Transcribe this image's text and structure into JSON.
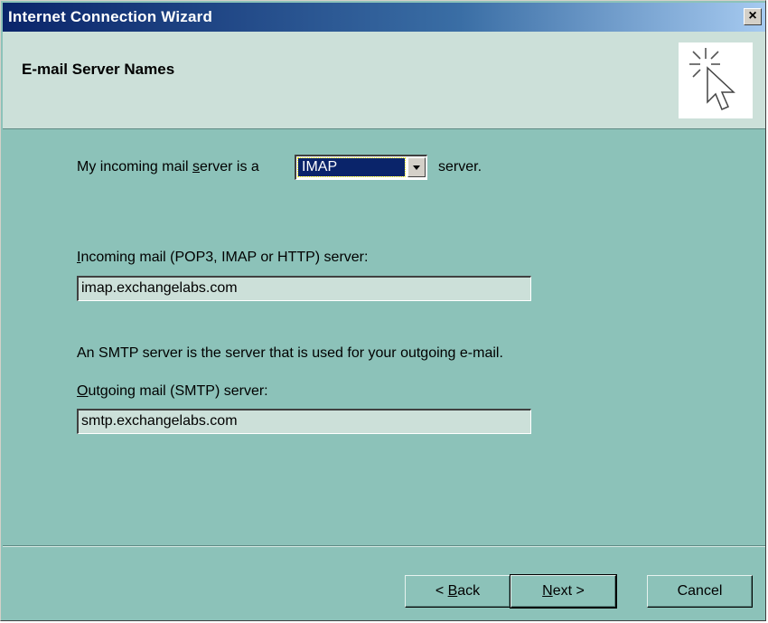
{
  "window": {
    "title": "Internet Connection Wizard",
    "close_label": "×"
  },
  "header": {
    "title": "E-mail Server Names",
    "icon": "wizard-cursor-icon"
  },
  "incoming_type": {
    "label_prefix": "My incoming mail ",
    "label_hotkey": "s",
    "label_suffix": "erver is a",
    "selected": "IMAP",
    "after_label": "server."
  },
  "incoming_server": {
    "label_hotkey": "I",
    "label_rest": "ncoming mail (POP3, IMAP or HTTP) server:",
    "value": "imap.exchangelabs.com"
  },
  "smtp_info": "An SMTP server is the server that is used for your outgoing e-mail.",
  "outgoing_server": {
    "label_hotkey": "O",
    "label_rest": "utgoing mail (SMTP) server:",
    "value": "smtp.exchangelabs.com"
  },
  "buttons": {
    "back_prefix": "< ",
    "back_hotkey": "B",
    "back_rest": "ack",
    "next_hotkey": "N",
    "next_rest": "ext >",
    "cancel": "Cancel"
  },
  "colors": {
    "titlebar": "#0a246a",
    "dialog_bg": "#8cc2b9",
    "header_bg": "#cce0d9",
    "selection": "#0a246a"
  }
}
